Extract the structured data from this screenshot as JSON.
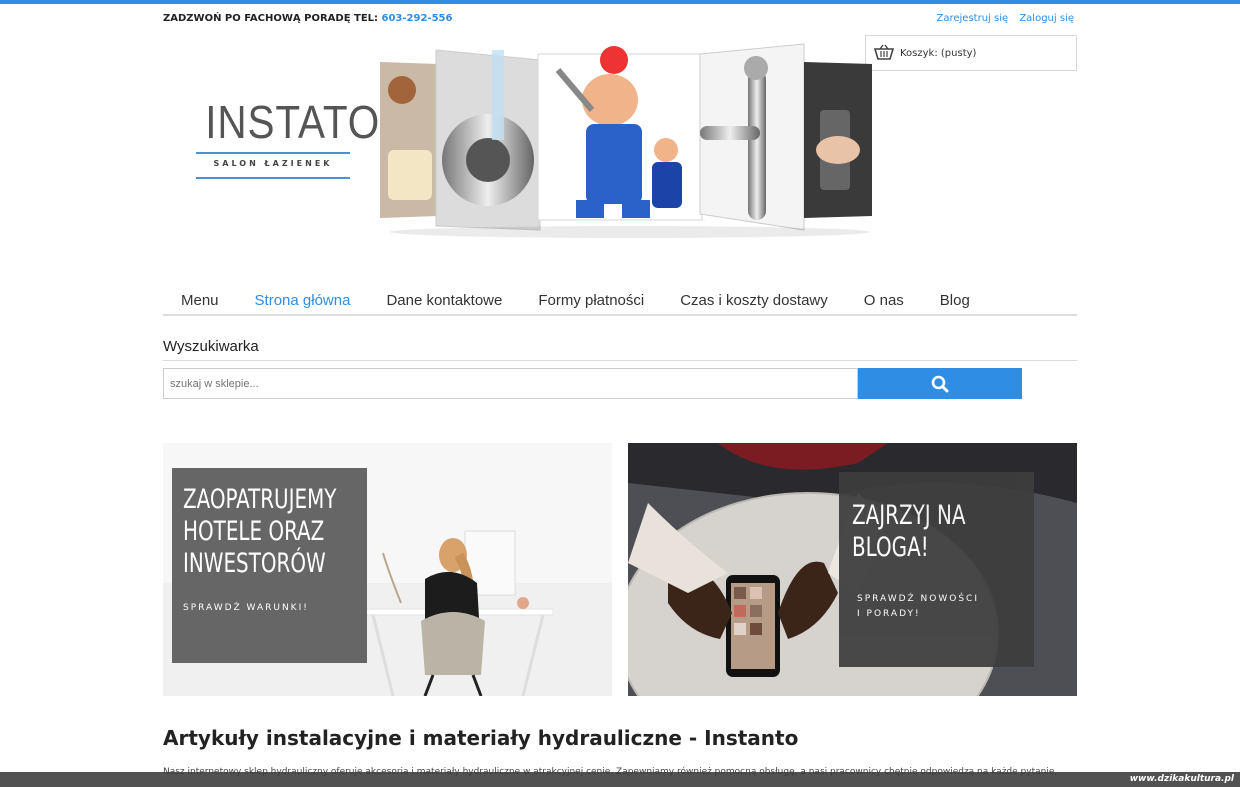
{
  "topbar": {
    "phone_label": "ZADZWOŃ PO FACHOWĄ PORADĘ TEL:",
    "phone_number": "603-292-556",
    "register": "Zarejestruj się",
    "login": "Zaloguj się"
  },
  "cart": {
    "label": "Koszyk: (pusty)"
  },
  "logo": {
    "name": "INSTATO",
    "tagline": "SALON ŁAZIENEK"
  },
  "nav": {
    "items": [
      "Menu",
      "Strona główna",
      "Dane kontaktowe",
      "Formy płatności",
      "Czas i koszty dostawy",
      "O nas",
      "Blog"
    ],
    "active_index": 1
  },
  "search": {
    "title": "Wyszukiwarka",
    "placeholder": "szukaj w sklepie..."
  },
  "banners": [
    {
      "title_lines": [
        "ZAOPATRUJEMY",
        "HOTELE  ORAZ",
        "INWESTORÓW"
      ],
      "cta": "SPRAWDŹ WARUNKI!"
    },
    {
      "title_lines": [
        "ZAJRZYJ NA",
        "BLOGA!"
      ],
      "cta_lines": [
        "SPRAWDŹ NOWOŚCI",
        "I PORADY!"
      ]
    }
  ],
  "article": {
    "title": "Artykuły instalacyjne i materiały hydrauliczne - Instanto",
    "body": "Nasz internetowy sklep hydrauliczny oferuje akcesoria i materiały hydrauliczne w atrakcyjnej cenie. Zapewniamy również pomocną obsługę, a nasi pracownicy chętnie odpowiedzą na każde pytanie,"
  },
  "watermark": "www.dzikakultura.pl",
  "colors": {
    "accent": "#2f8de4",
    "banner_box": "#666666"
  }
}
